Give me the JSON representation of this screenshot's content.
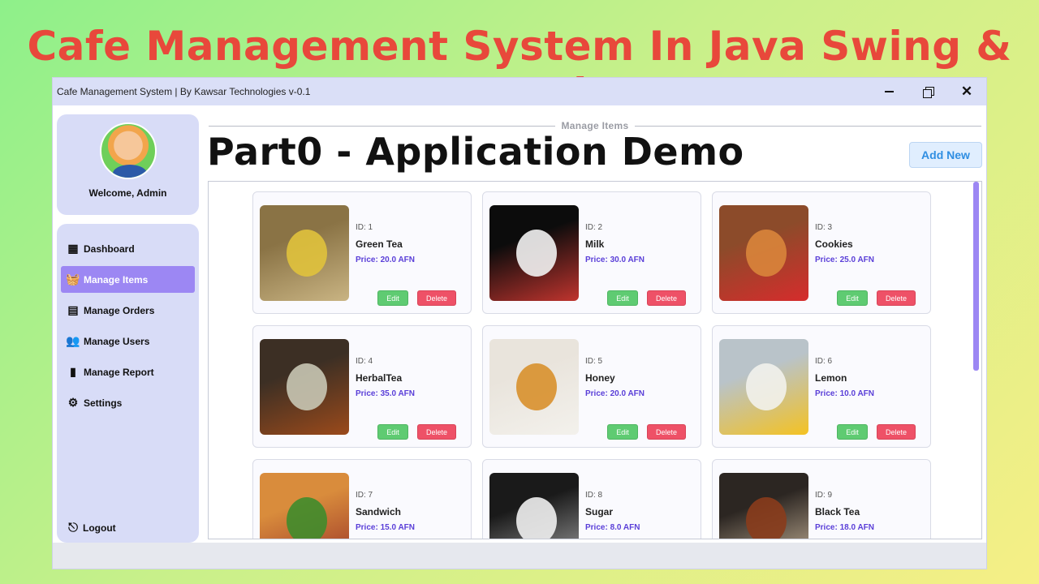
{
  "banner": "Cafe Management System In Java Swing & Mysql",
  "window": {
    "title": "Cafe Management System  | By Kawsar Technologies v-0.1",
    "close_glyph": "✕"
  },
  "profile": {
    "welcome": "Welcome, Admin"
  },
  "menu": [
    {
      "label": "Dashboard",
      "icon": "dashboard-icon",
      "glyph": "▦",
      "active": false
    },
    {
      "label": "Manage Items",
      "icon": "basket-icon",
      "glyph": "🧺",
      "active": true
    },
    {
      "label": "Manage Orders",
      "icon": "orders-icon",
      "glyph": "▤",
      "active": false
    },
    {
      "label": "Manage Users",
      "icon": "users-icon",
      "glyph": "👥",
      "active": false
    },
    {
      "label": "Manage Report",
      "icon": "report-icon",
      "glyph": "▮",
      "active": false
    },
    {
      "label": "Settings",
      "icon": "gear-icon",
      "glyph": "⚙",
      "active": false
    }
  ],
  "logout": {
    "label": "Logout",
    "icon": "logout-icon",
    "glyph": "⎋"
  },
  "section_label": "Manage Items",
  "overlay_title": "Part0 - Application Demo",
  "add_new_label": "Add New",
  "edit_label": "Edit",
  "delete_label": "Delete",
  "items": [
    {
      "id": "ID: 1",
      "name": "Green Tea",
      "price": "Price: 20.0 AFN",
      "colors": [
        "#8a7345",
        "#e0c23c",
        "#c9b483"
      ]
    },
    {
      "id": "ID: 2",
      "name": "Milk",
      "price": "Price: 30.0 AFN",
      "colors": [
        "#0c0c0c",
        "#f2f2f2",
        "#c0342e"
      ]
    },
    {
      "id": "ID: 3",
      "name": "Cookies",
      "price": "Price: 25.0 AFN",
      "colors": [
        "#8c4b2a",
        "#d9853b",
        "#d62c2c"
      ]
    },
    {
      "id": "ID: 4",
      "name": "HerbalTea",
      "price": "Price: 35.0 AFN",
      "colors": [
        "#3c2f24",
        "#c8c6b4",
        "#9b4a1b"
      ]
    },
    {
      "id": "ID: 5",
      "name": "Honey",
      "price": "Price: 20.0 AFN",
      "colors": [
        "#e9e4dc",
        "#d8902c",
        "#f3f1ec"
      ]
    },
    {
      "id": "ID: 6",
      "name": "Lemon",
      "price": "Price: 10.0 AFN",
      "colors": [
        "#b9c3c9",
        "#f2f2ec",
        "#f4c222"
      ]
    },
    {
      "id": "ID: 7",
      "name": "Sandwich",
      "price": "Price: 15.0 AFN",
      "colors": [
        "#d98c3c",
        "#3f8c2c",
        "#9a3428"
      ]
    },
    {
      "id": "ID: 8",
      "name": "Sugar",
      "price": "Price: 8.0 AFN",
      "colors": [
        "#1a1a1a",
        "#f0f0f0",
        "#a0a0a0"
      ]
    },
    {
      "id": "ID: 9",
      "name": "Black Tea",
      "price": "Price: 18.0 AFN",
      "colors": [
        "#2c2622",
        "#8a3c1c",
        "#c9b59a"
      ]
    }
  ]
}
